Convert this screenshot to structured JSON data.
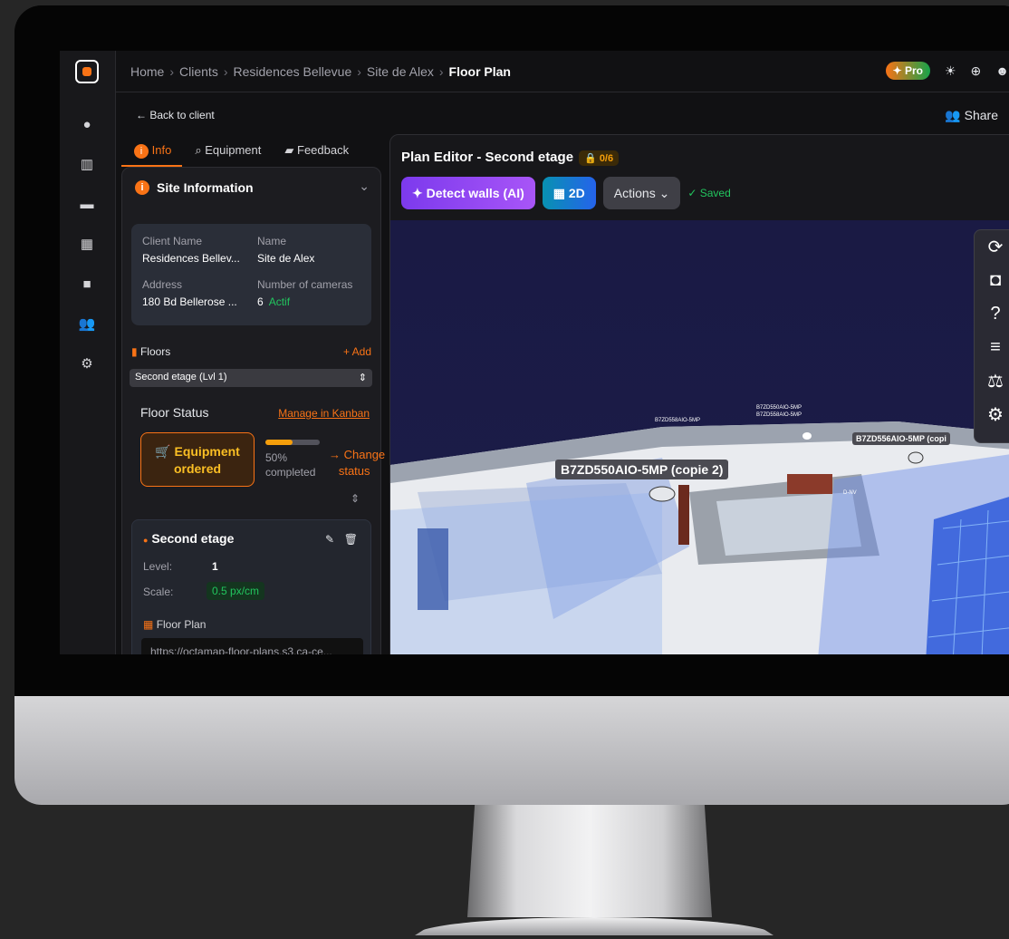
{
  "breadcrumb": [
    "Home",
    "Clients",
    "Residences Bellevue",
    "Site de Alex",
    "Floor Plan"
  ],
  "header": {
    "pro_label": "Pro",
    "back_label": "Back to client",
    "share_label": "Share"
  },
  "tabs": [
    "Info",
    "Equipment",
    "Feedback"
  ],
  "site": {
    "title": "Site Information",
    "client_name_label": "Client Name",
    "client_name": "Residences Bellev...",
    "name_label": "Name",
    "name": "Site de Alex",
    "address_label": "Address",
    "address": "180 Bd Bellerose ...",
    "cameras_label": "Number of cameras",
    "cameras": "6",
    "cameras_status": "Actif"
  },
  "floors": {
    "label": "Floors",
    "add_label": "+ Add",
    "selected": "Second etage (Lvl 1)"
  },
  "floor_status": {
    "title": "Floor Status",
    "kanban_link": "Manage in Kanban",
    "status_line1": "Equipment",
    "status_line2": "ordered",
    "progress": 0.5,
    "progress_line1": "50%",
    "progress_line2": "completed",
    "change_line1": "→ Change",
    "change_line2": "status"
  },
  "floor_card": {
    "title": "Second etage",
    "level_label": "Level:",
    "level": "1",
    "scale_label": "Scale:",
    "scale": "0.5 px/cm",
    "plan_label": "Floor Plan",
    "plan_url": "https://octamap-floor-plans.s3.ca-ce..."
  },
  "editor": {
    "title": "Plan Editor - Second etage",
    "lock_badge": "0/6",
    "detect_label": "Detect walls (AI)",
    "mode_label": "2D",
    "actions_label": "Actions",
    "saved_label": "✓ Saved"
  },
  "canvas_labels": {
    "main": "B7ZD550AIO-5MP (copie 2)",
    "right": "B7ZD556AIO-5MP (copi",
    "tiny1": "B7ZD558AIO-5MP",
    "tiny2": "B7ZD558AIO-5MP",
    "tiny3": "B7ZD550AIO-5MP",
    "tiny4": "D-NV"
  },
  "colors": {
    "accent": "#f97316",
    "success": "#22c55e",
    "ai": "#7c3aed",
    "mode": "#2563eb"
  }
}
